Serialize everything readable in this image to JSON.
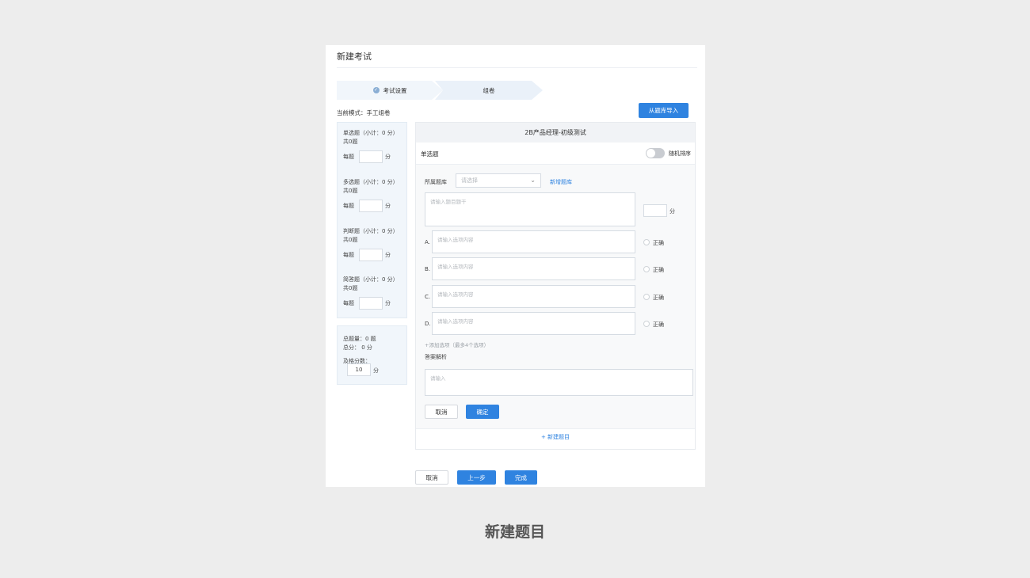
{
  "page": {
    "title": "新建考试",
    "caption": "新建题目"
  },
  "steps": [
    {
      "label": "考试设置",
      "done": true
    },
    {
      "label": "组卷",
      "done": false
    }
  ],
  "mode_text": "当前模式：手工组卷",
  "import_button": "从题库导入",
  "left_panel": {
    "types": [
      {
        "title": "单选题（小计：0 分）",
        "count": "共0题",
        "per_label": "每题",
        "unit": "分"
      },
      {
        "title": "多选题（小计：0 分）",
        "count": "共0题",
        "per_label": "每题",
        "unit": "分"
      },
      {
        "title": "判断题（小计：0 分）",
        "count": "共0题",
        "per_label": "每题",
        "unit": "分"
      },
      {
        "title": "简答题（小计：0 分）",
        "count": "共0题",
        "per_label": "每题",
        "unit": "分"
      }
    ],
    "summary": {
      "total_count": "总题量：0 题",
      "total_score": "总分： 0 分",
      "pass_label": "及格分数：",
      "pass_value": "10",
      "unit": "分"
    }
  },
  "editor": {
    "exam_title": "2B产品经理-初级测试",
    "section_label": "单选题",
    "random_order_label": "随机排序",
    "bank_label": "所属题库",
    "bank_placeholder": "请选择",
    "new_bank_link": "新增题库",
    "stem_placeholder": "请输入题目题干",
    "score_unit": "分",
    "options": [
      {
        "letter": "A.",
        "placeholder": "请输入选项内容",
        "correct_label": "正确"
      },
      {
        "letter": "B.",
        "placeholder": "请输入选项内容",
        "correct_label": "正确"
      },
      {
        "letter": "C.",
        "placeholder": "请输入选项内容",
        "correct_label": "正确"
      },
      {
        "letter": "D.",
        "placeholder": "请输入选项内容",
        "correct_label": "正确"
      }
    ],
    "add_option_hint": "+添加选项（最多4个选项）",
    "analysis_label": "答案解析",
    "analysis_placeholder": "请输入",
    "cancel": "取消",
    "confirm": "确定",
    "add_question": "+ 新建题目"
  },
  "footer": {
    "cancel": "取消",
    "prev": "上一步",
    "finish": "完成"
  },
  "colors": {
    "primary": "#2f83e0",
    "panel_bg": "#f1f6fb",
    "page_bg": "#ededed"
  }
}
